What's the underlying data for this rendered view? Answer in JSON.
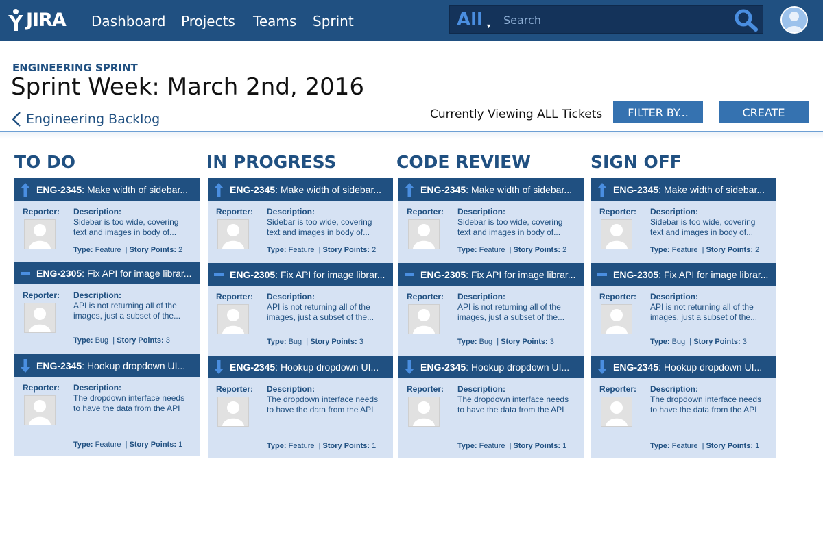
{
  "app": {
    "logo_text": "JIRA"
  },
  "nav": {
    "items": [
      "Dashboard",
      "Projects",
      "Teams",
      "Sprint"
    ]
  },
  "search": {
    "scope": "All",
    "placeholder": "Search"
  },
  "header": {
    "project_label": "ENGINEERING SPRINT",
    "title": "Sprint Week: March 2nd, 2016",
    "breadcrumb": "Engineering Backlog",
    "viewing_prefix": "Currently Viewing",
    "viewing_value": "ALL",
    "viewing_suffix": "Tickets",
    "filter_label": "FILTER BY...",
    "create_label": "CREATE"
  },
  "labels": {
    "reporter": "Reporter:",
    "description": "Description:",
    "type": "Type:",
    "story_points": "Story Points:"
  },
  "colors": {
    "nav_bg": "#205081",
    "accent": "#3572b0",
    "card_bg": "#d6e2f3",
    "priority_icon": "#4a8ee0"
  },
  "columns": [
    {
      "title": "TO DO",
      "cards": [
        {
          "priority_icon": "arrow-up-icon",
          "key": "ENG-2345",
          "summary": "Make width of sidebar...",
          "description": "Sidebar is too wide, covering text and images in body of...",
          "type": "Feature",
          "points": "2"
        },
        {
          "priority_icon": "minus-icon",
          "key": "ENG-2305",
          "summary": "Fix API for image librar...",
          "description": "API is not returning all of the images, just a subset of the...",
          "type": "Bug",
          "points": "3"
        },
        {
          "priority_icon": "arrow-down-icon",
          "key": "ENG-2345",
          "summary": "Hookup dropdown UI...",
          "description": "The dropdown interface needs to have the data from the API",
          "type": "Feature",
          "points": "1"
        }
      ]
    },
    {
      "title": "IN PROGRESS",
      "cards": [
        {
          "priority_icon": "arrow-up-icon",
          "key": "ENG-2345",
          "summary": "Make width of sidebar...",
          "description": "Sidebar is too wide, covering text and images in body of...",
          "type": "Feature",
          "points": "2"
        },
        {
          "priority_icon": "minus-icon",
          "key": "ENG-2305",
          "summary": "Fix API for image librar...",
          "description": "API is not returning all of the images, just a subset of the...",
          "type": "Bug",
          "points": "3"
        },
        {
          "priority_icon": "arrow-down-icon",
          "key": "ENG-2345",
          "summary": "Hookup dropdown UI...",
          "description": "The dropdown interface needs to have the data from the API",
          "type": "Feature",
          "points": "1"
        }
      ]
    },
    {
      "title": "CODE REVIEW",
      "cards": [
        {
          "priority_icon": "arrow-up-icon",
          "key": "ENG-2345",
          "summary": "Make width of sidebar...",
          "description": "Sidebar is too wide, covering text and images in body of...",
          "type": "Feature",
          "points": "2"
        },
        {
          "priority_icon": "minus-icon",
          "key": "ENG-2305",
          "summary": "Fix API for image librar...",
          "description": "API is not returning all of the images, just a subset of the...",
          "type": "Bug",
          "points": "3"
        },
        {
          "priority_icon": "arrow-down-icon",
          "key": "ENG-2345",
          "summary": "Hookup dropdown UI...",
          "description": "The dropdown interface needs to have the data from the API",
          "type": "Feature",
          "points": "1"
        }
      ]
    },
    {
      "title": "SIGN OFF",
      "cards": [
        {
          "priority_icon": "arrow-up-icon",
          "key": "ENG-2345",
          "summary": "Make width of sidebar...",
          "description": "Sidebar is too wide, covering text and images in body of...",
          "type": "Feature",
          "points": "2"
        },
        {
          "priority_icon": "minus-icon",
          "key": "ENG-2305",
          "summary": "Fix API for image librar...",
          "description": "API is not returning all of the images, just a subset of the...",
          "type": "Bug",
          "points": "3"
        },
        {
          "priority_icon": "arrow-down-icon",
          "key": "ENG-2345",
          "summary": "Hookup dropdown UI...",
          "description": "The dropdown interface needs to have the data from the API",
          "type": "Feature",
          "points": "1"
        }
      ]
    }
  ]
}
